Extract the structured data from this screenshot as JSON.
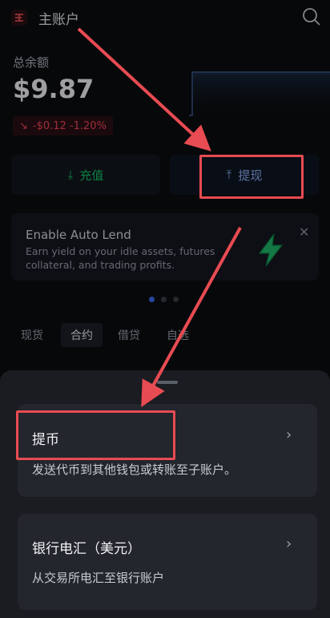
{
  "header": {
    "account_label": "主账户",
    "icon": "account-logo-icon",
    "search_icon": "search-icon"
  },
  "balance": {
    "label": "总余额",
    "value": "$9.87",
    "change": "-$0.12 -1.20%"
  },
  "actions": {
    "deposit": "充值",
    "withdraw": "提现"
  },
  "promo": {
    "title": "Enable Auto Lend",
    "description": "Earn yield on your idle assets, futures collateral, and trading profits."
  },
  "carousel": {
    "count": 3,
    "active_index": 0
  },
  "tabs": [
    {
      "label": "现货",
      "active": false
    },
    {
      "label": "合约",
      "active": true
    },
    {
      "label": "借贷",
      "active": false
    },
    {
      "label": "自选",
      "active": false
    }
  ],
  "sheet": {
    "options": [
      {
        "title": "提币",
        "description": "发送代币到其他钱包或转账至子账户。"
      },
      {
        "title": "银行电汇（美元）",
        "description": "从交易所电汇至银行账户"
      }
    ]
  },
  "colors": {
    "accent_green": "#17c46a",
    "accent_red": "#f5475a",
    "accent_blue": "#3b6cf4",
    "annotation_red": "#e84b52"
  }
}
